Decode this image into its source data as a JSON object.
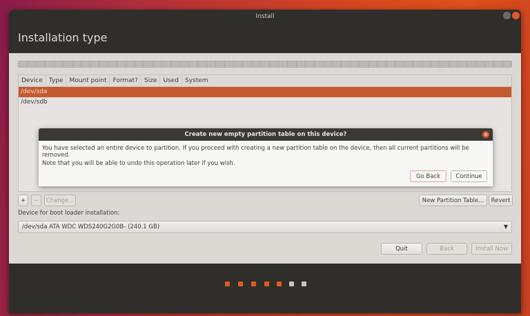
{
  "window": {
    "title": "Install",
    "heading": "Installation type"
  },
  "table": {
    "columns": [
      "Device",
      "Type",
      "Mount point",
      "Format?",
      "Size",
      "Used",
      "System"
    ],
    "rows": [
      {
        "device": "/dev/sda",
        "selected": true
      },
      {
        "device": "/dev/sdb",
        "selected": false
      }
    ]
  },
  "dialog": {
    "title": "Create new empty partition table on this device?",
    "message": "You have selected an entire device to partition. If you proceed with creating a new partition table on the device, then all current partitions will be removed.",
    "note": "Note that you will be able to undo this operation later if you wish.",
    "go_back": "Go Back",
    "continue": "Continue"
  },
  "toolbar": {
    "add": "+",
    "remove": "−",
    "change": "Change...",
    "new_table": "New Partition Table...",
    "revert": "Revert"
  },
  "bootloader": {
    "label": "Device for boot loader installation:",
    "value": "/dev/sda  ATA WDC WDS240G2G0B- (240.1 GB)"
  },
  "buttons": {
    "quit": "Quit",
    "back": "Back",
    "install": "Install Now"
  },
  "progress": {
    "step": 5,
    "total": 7
  },
  "colors": {
    "accent": "#e05a24",
    "selected_row": "#c45a30"
  }
}
